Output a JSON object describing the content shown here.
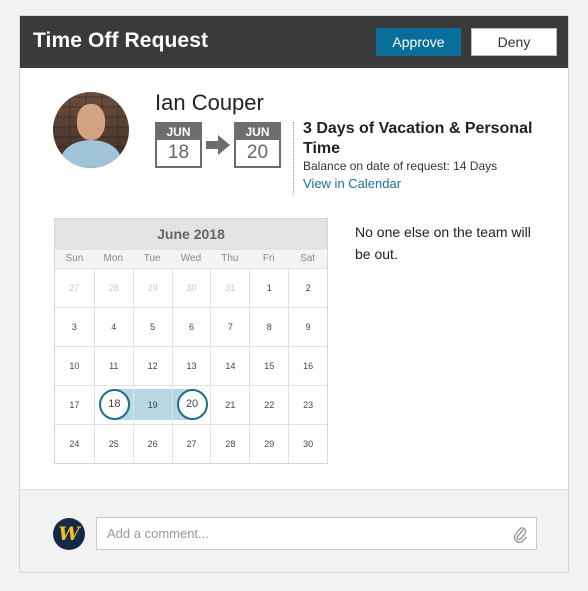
{
  "header": {
    "title": "Time Off Request",
    "approve_label": "Approve",
    "deny_label": "Deny"
  },
  "request": {
    "employee_name": "Ian Couper",
    "from": {
      "month": "JUN",
      "day": "18"
    },
    "to": {
      "month": "JUN",
      "day": "20"
    },
    "summary": "3 Days of Vacation & Personal Time",
    "balance": "Balance on date of request: 14 Days",
    "calendar_link": "View in Calendar"
  },
  "calendar": {
    "title": "June 2018",
    "days_of_week": [
      "Sun",
      "Mon",
      "Tue",
      "Wed",
      "Thu",
      "Fri",
      "Sat"
    ],
    "weeks": [
      [
        "27",
        "28",
        "29",
        "30",
        "31",
        "1",
        "2"
      ],
      [
        "3",
        "4",
        "5",
        "6",
        "7",
        "8",
        "9"
      ],
      [
        "10",
        "11",
        "12",
        "13",
        "14",
        "15",
        "16"
      ],
      [
        "17",
        "18",
        "19",
        "20",
        "21",
        "22",
        "23"
      ],
      [
        "24",
        "25",
        "26",
        "27",
        "28",
        "29",
        "30"
      ]
    ],
    "selected_start": "18",
    "selected_end": "20",
    "range_color": "#b7d7e2",
    "ring_color": "#1a6e8f"
  },
  "team_note": "No one else on the team will be out.",
  "comment": {
    "placeholder": "Add a comment..."
  },
  "colors": {
    "header_bg": "#3a3a3a",
    "approve_bg": "#0a6e9a",
    "link": "#1a6fa8"
  }
}
